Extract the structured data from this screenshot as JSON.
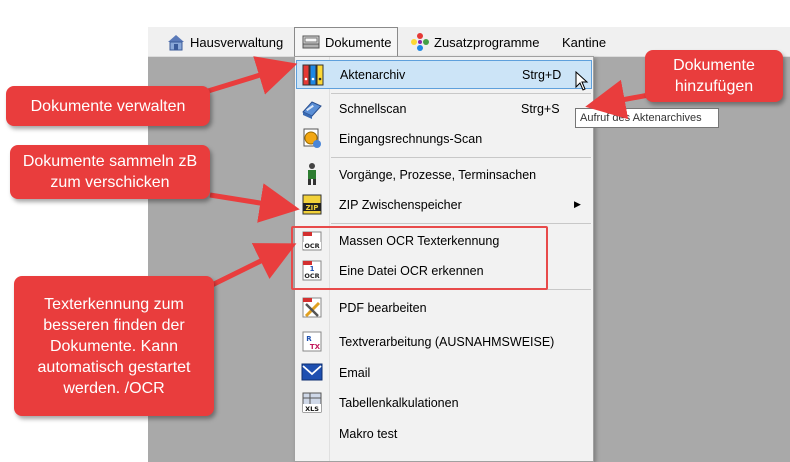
{
  "menubar": {
    "items": [
      {
        "label": "Hausverwaltung",
        "icon": "house-icon"
      },
      {
        "label": "Dokumente",
        "icon": "folder-tray-icon"
      },
      {
        "label": "Zusatzprogramme",
        "icon": "color-pinwheel-icon"
      },
      {
        "label": "Kantine"
      }
    ]
  },
  "menu": {
    "items": [
      {
        "label": "Aktenarchiv",
        "shortcut": "Strg+D",
        "icon": "binders-icon",
        "highlighted": true
      },
      {
        "label": "Schnellscan",
        "shortcut": "Strg+S",
        "icon": "scanner-icon"
      },
      {
        "label": "Eingangsrechnungs-Scan",
        "icon": "invoice-scan-icon"
      },
      {
        "label": "Vorgänge, Prozesse, Terminsachen",
        "icon": "person-process-icon"
      },
      {
        "label": "ZIP Zwischenspeicher",
        "icon": "zip-icon",
        "submenu": true
      },
      {
        "label": "Massen OCR Texterkennung",
        "icon": "pdf-ocr-icon"
      },
      {
        "label": "Eine Datei OCR erkennen",
        "icon": "pdf-ocr-single-icon"
      },
      {
        "label": "PDF bearbeiten",
        "icon": "pdf-edit-icon"
      },
      {
        "label": "Textverarbeitung (AUSNAHMSWEISE)",
        "icon": "rtf-icon"
      },
      {
        "label": "Email",
        "icon": "email-icon"
      },
      {
        "label": "Tabellenkalkulationen",
        "icon": "xls-icon"
      },
      {
        "label": "Makro test"
      }
    ]
  },
  "tooltip": "Aufruf des Aktenarchives",
  "callouts": {
    "verwalten": "Dokumente verwalten",
    "sammeln": "Dokumente sammeln zB zum verschicken",
    "ocr": "Texterkennung zum besseren finden der Dokumente. Kann automatisch gestartet werden. /OCR",
    "hinzufuegen": "Dokumente hinzufügen"
  },
  "colors": {
    "callout": "#e93d3d",
    "highlight": "#cce4f7",
    "highlight_border": "#5fa0dc",
    "app_background": "#a9a9a9"
  }
}
